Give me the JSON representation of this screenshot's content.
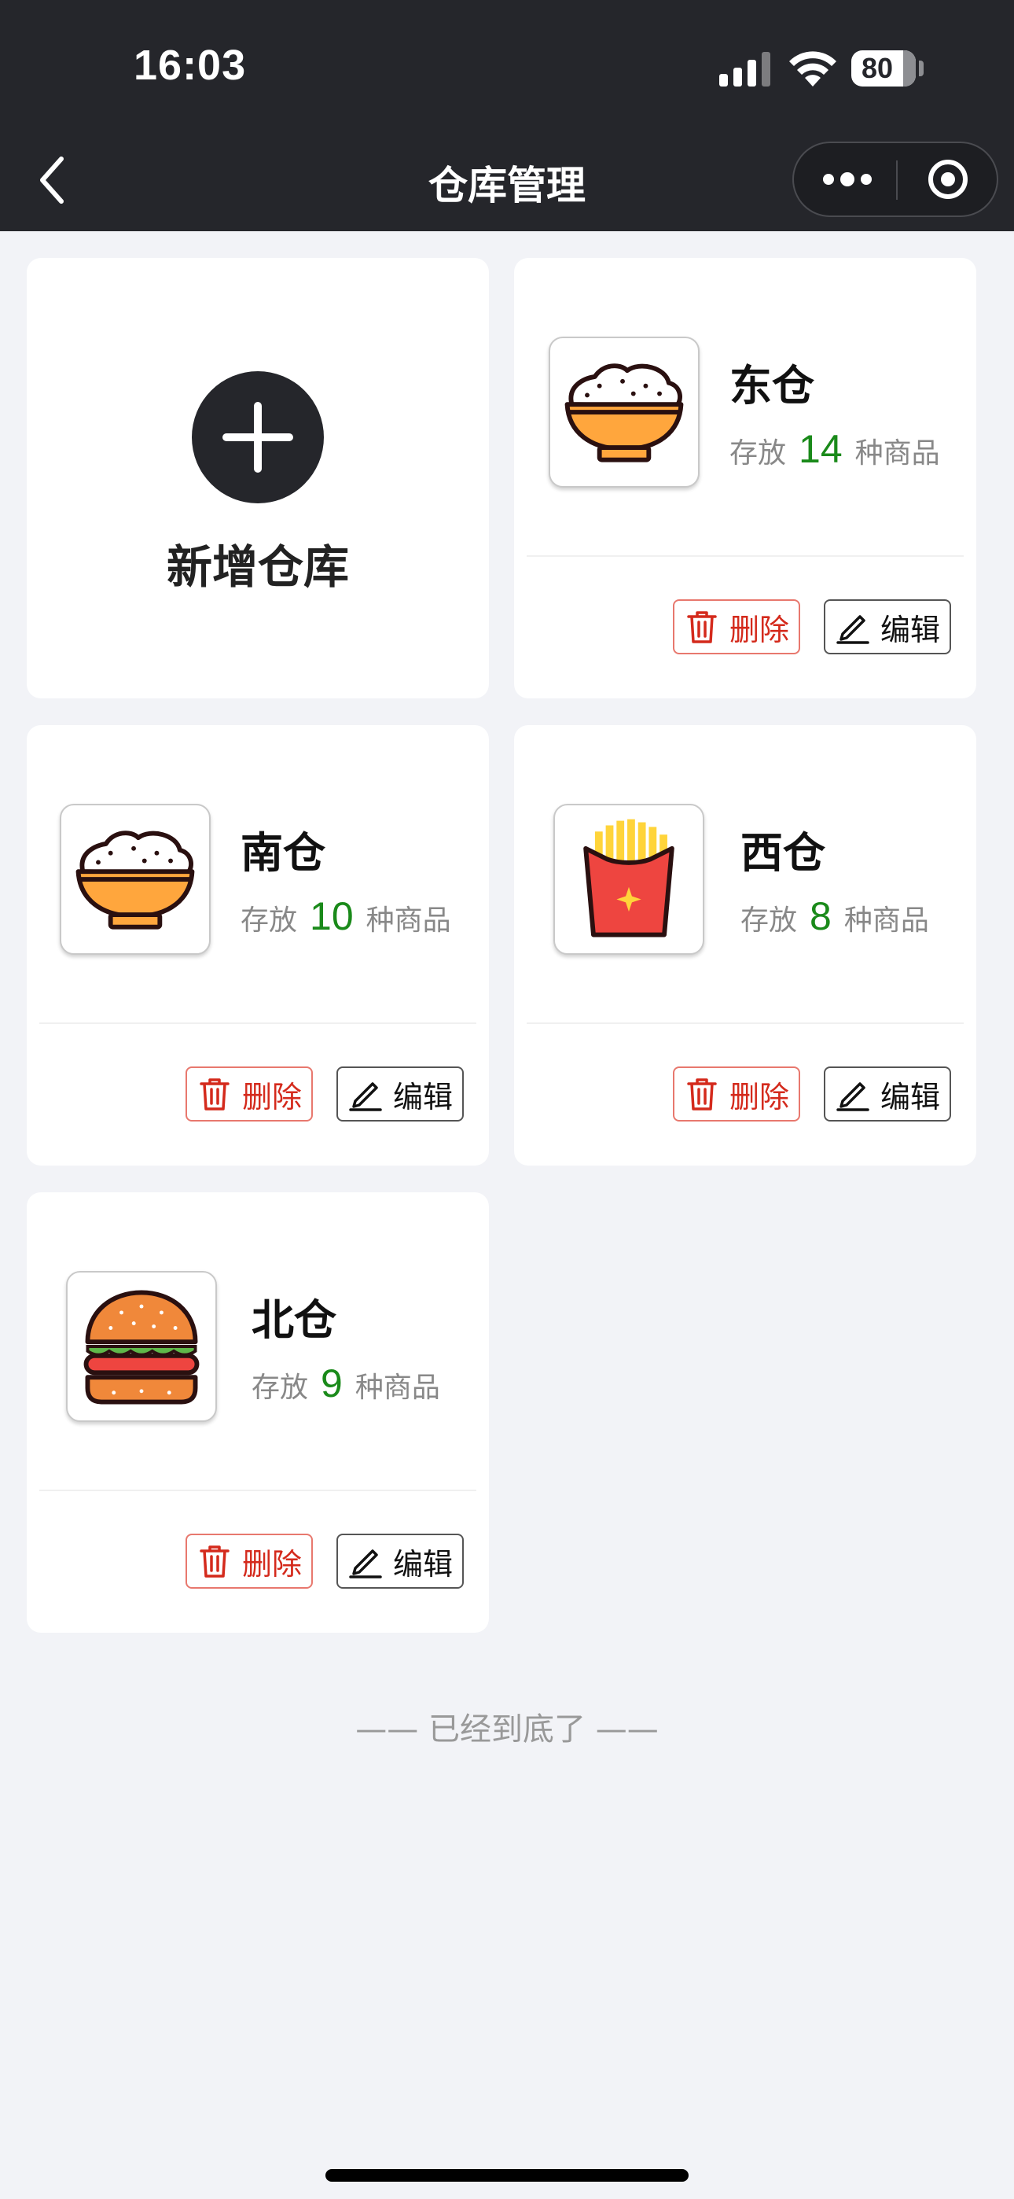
{
  "status_bar": {
    "time": "16:03",
    "battery": "80"
  },
  "nav": {
    "title": "仓库管理"
  },
  "add_card": {
    "label": "新增仓库"
  },
  "warehouses": [
    {
      "name": "东仓",
      "prefix": "存放",
      "count": "14",
      "suffix": "种商品",
      "icon": "rice-bowl-icon"
    },
    {
      "name": "南仓",
      "prefix": "存放",
      "count": "10",
      "suffix": "种商品",
      "icon": "rice-bowl-icon"
    },
    {
      "name": "西仓",
      "prefix": "存放",
      "count": "8",
      "suffix": "种商品",
      "icon": "french-fries-icon"
    },
    {
      "name": "北仓",
      "prefix": "存放",
      "count": "9",
      "suffix": "种商品",
      "icon": "burger-icon"
    }
  ],
  "actions": {
    "delete": "删除",
    "edit": "编辑"
  },
  "footer": {
    "end_note": "—— 已经到底了 ——"
  },
  "colors": {
    "header_bg": "#25262b",
    "count_green": "#1a8a1a",
    "delete_red": "#d42a1c",
    "page_bg": "#f2f3f7"
  }
}
